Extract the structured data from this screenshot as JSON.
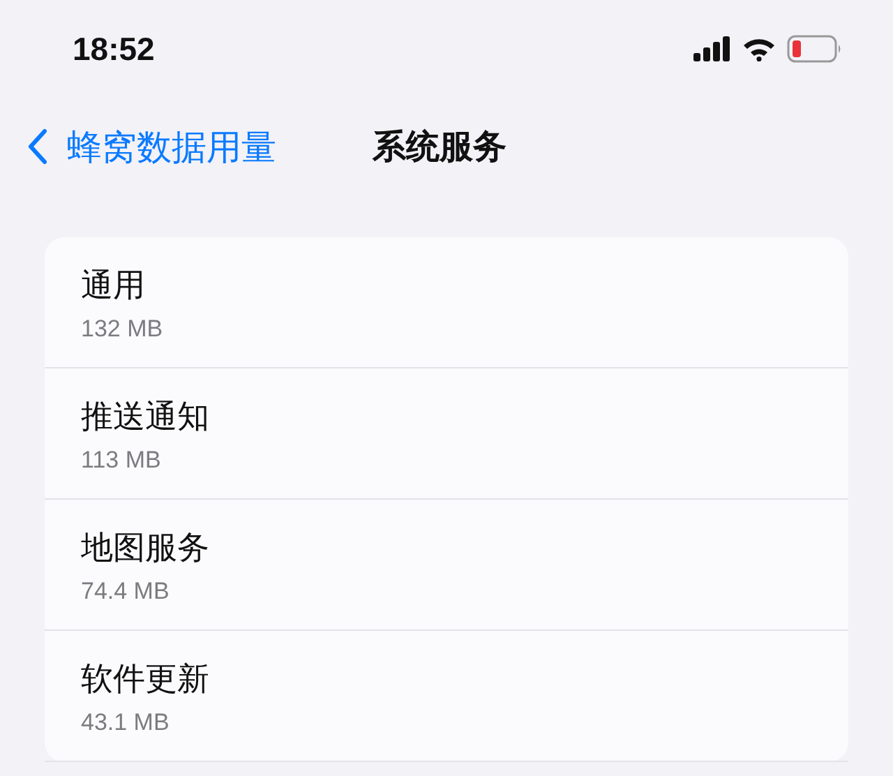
{
  "status_bar": {
    "time": "18:52"
  },
  "nav": {
    "back_label": "蜂窝数据用量",
    "title": "系统服务"
  },
  "items": [
    {
      "title": "通用",
      "usage": "132 MB"
    },
    {
      "title": "推送通知",
      "usage": "113 MB"
    },
    {
      "title": "地图服务",
      "usage": "74.4 MB"
    },
    {
      "title": "软件更新",
      "usage": "43.1 MB"
    }
  ]
}
